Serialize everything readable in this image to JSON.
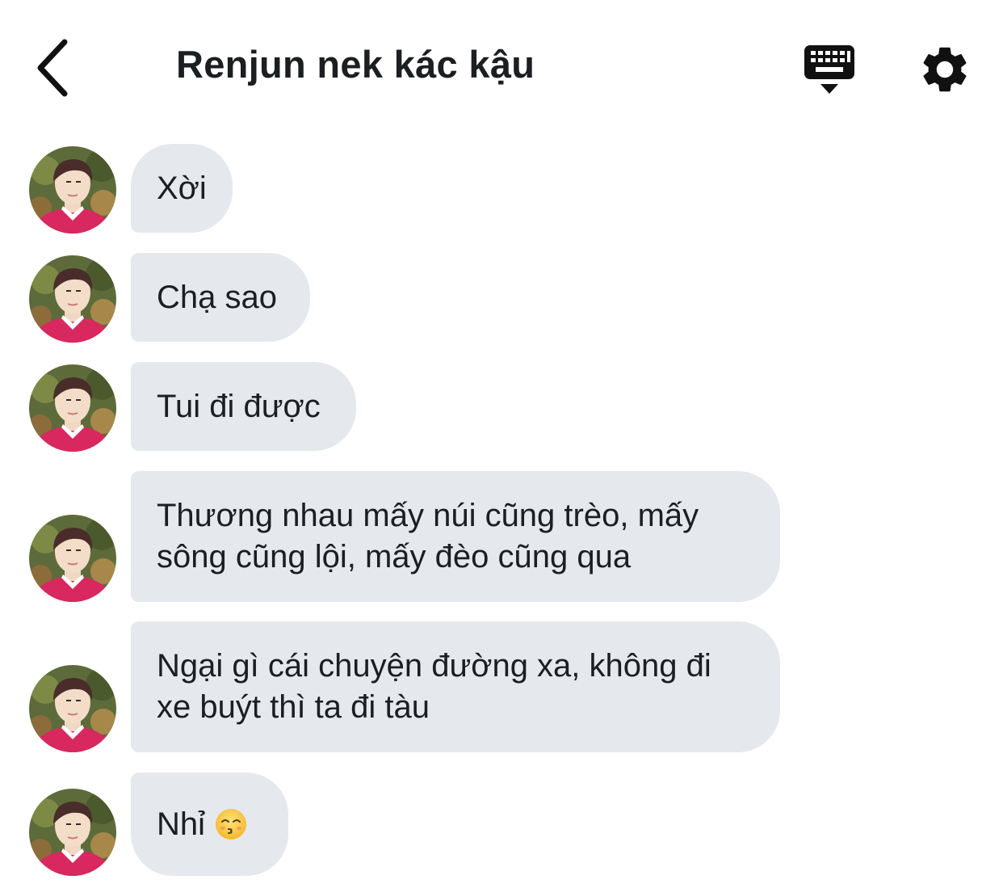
{
  "header": {
    "title": "Renjun nek kác kậu",
    "back_icon": "chevron-left-icon",
    "keyboard_icon": "keyboard-hide-icon",
    "settings_icon": "gear-icon"
  },
  "messages": [
    {
      "text": "Xời"
    },
    {
      "text": "Chạ sao"
    },
    {
      "text": "Tui đi được"
    },
    {
      "text": "Thương nhau mấy núi cũng trèo, mấy sông cũng lội, mấy đèo cũng qua"
    },
    {
      "text": "Ngại gì cái chuyện đường xa, không đi xe buýt thì ta đi tàu"
    },
    {
      "text": "Nhỉ",
      "emoji": "kissing-face-smiling-eyes-emoji"
    }
  ],
  "colors": {
    "bubble_bg": "#e5e9ee",
    "text": "#1c1e21",
    "avatar_sweater": "#d8285f"
  }
}
